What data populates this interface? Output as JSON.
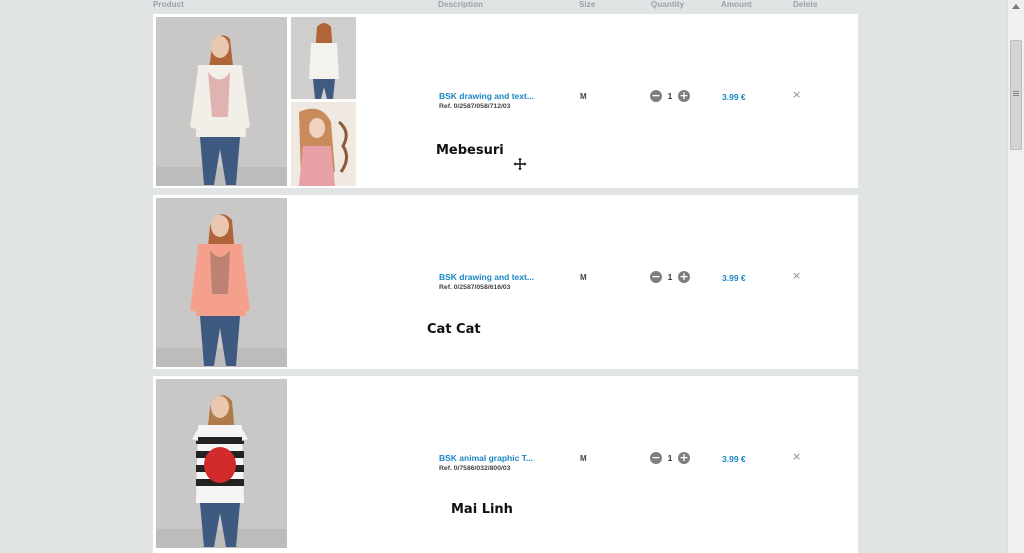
{
  "columns": {
    "product": "Product",
    "description": "Description",
    "size": "Size",
    "quantity": "Quantity",
    "amount": "Amount",
    "delete": "Delete"
  },
  "quantity_controls": {
    "minus": "−",
    "plus": "+"
  },
  "delete_symbol": "×",
  "items": [
    {
      "name": "BSK drawing and text...",
      "ref": "Ref. 0/2587/058/712/03",
      "size": "M",
      "quantity": "1",
      "amount": "3.99 €",
      "overlay_label": "Mebesuri",
      "shirt_color": "#f2efe8"
    },
    {
      "name": "BSK drawing and text...",
      "ref": "Ref. 0/2587/058/616/03",
      "size": "M",
      "quantity": "1",
      "amount": "3.99 €",
      "overlay_label": "Cat Cat",
      "shirt_color": "#f4a08c"
    },
    {
      "name": "BSK animal graphic T...",
      "ref": "Ref. 0/7586/032/800/03",
      "size": "M",
      "quantity": "1",
      "amount": "3.99 €",
      "overlay_label": "Mai Linh",
      "shirt_color": "#f5f5f5"
    }
  ]
}
